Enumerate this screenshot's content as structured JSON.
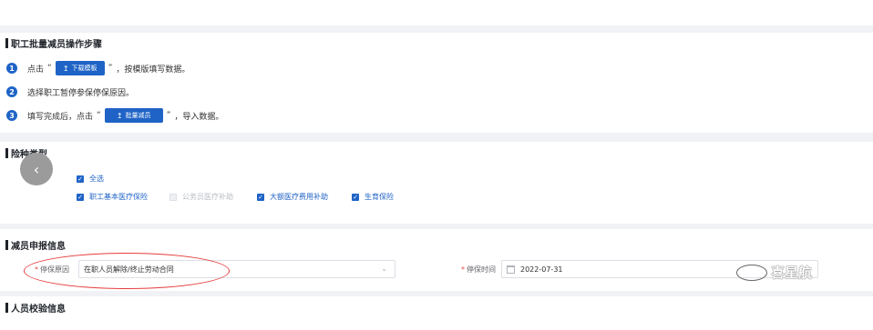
{
  "steps_section": {
    "title": "职工批量减员操作步骤",
    "steps": [
      {
        "num": "1",
        "before": "点击",
        "quote_open": "“",
        "button": "下载模板",
        "quote_close": "”",
        "after": "，按模版填写数据。"
      },
      {
        "num": "2",
        "text": "选择职工暂停参保停保原因。"
      },
      {
        "num": "3",
        "before": "填写完成后，点击",
        "quote_open": "“",
        "button": "批量减员",
        "quote_close": "”",
        "after": "，导入数据。"
      }
    ]
  },
  "insurance_section": {
    "title": "险种类型",
    "select_all": "全选",
    "options": [
      {
        "label": "职工基本医疗保险",
        "checked": true
      },
      {
        "label": "公务员医疗补助",
        "checked": false
      },
      {
        "label": "大额医疗费用补助",
        "checked": true
      },
      {
        "label": "生育保险",
        "checked": true
      }
    ]
  },
  "declaration_section": {
    "title": "减员申报信息",
    "reason_label": "停保原因",
    "reason_value": "在职人员解除/终止劳动合同",
    "time_label": "停保时间",
    "time_value": "2022-07-31"
  },
  "check_section": {
    "title": "人员校验信息"
  },
  "watermark": "喜星航",
  "icons": {
    "upload": "↥",
    "back": "‹",
    "check": "✓",
    "dropdown": "⌄"
  },
  "colors": {
    "primary": "#1f63c6",
    "annotation": "#e63c3c"
  }
}
